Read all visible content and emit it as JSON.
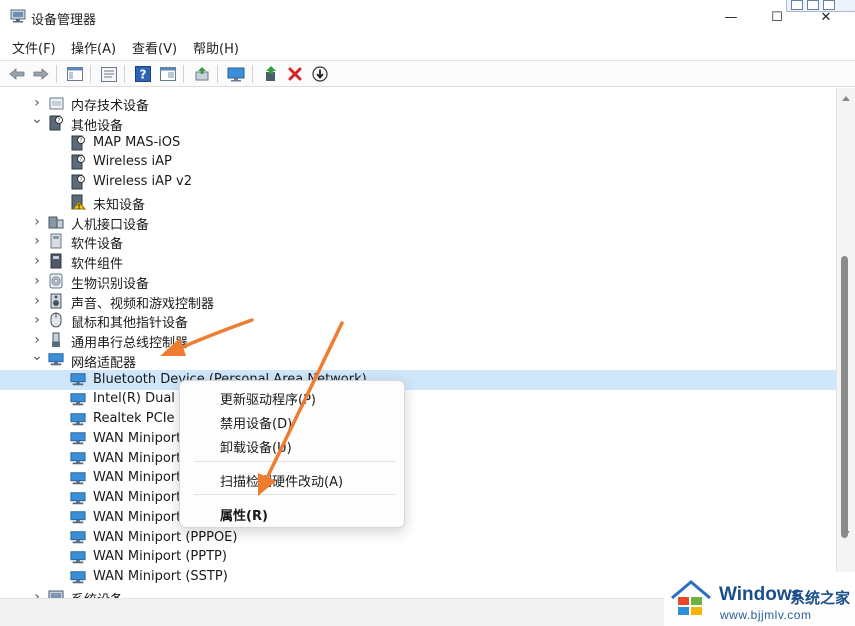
{
  "window": {
    "title": "设备管理器",
    "minimize_glyph": "—",
    "maximize_glyph": "☐",
    "close_glyph": "✕"
  },
  "menu": [
    "文件(F)",
    "操作(A)",
    "查看(V)",
    "帮助(H)"
  ],
  "toolbar": [
    "back-arrow-icon",
    "forward-arrow-icon",
    "show-hide-tree-icon",
    "properties-icon",
    "help-icon",
    "console-view-icon",
    "update-driver-icon",
    "monitor-icon",
    "enable-device-icon",
    "uninstall-icon",
    "download-icon"
  ],
  "tree": [
    {
      "label": "内存技术设备",
      "state": "collapsed",
      "level": 0,
      "icon": "memory-icon"
    },
    {
      "label": "其他设备",
      "state": "expanded",
      "level": 0,
      "icon": "other-device-icon"
    },
    {
      "label": "MAP MAS-iOS",
      "level": 1,
      "icon": "unknown-device-icon"
    },
    {
      "label": "Wireless iAP",
      "level": 1,
      "icon": "unknown-device-icon"
    },
    {
      "label": "Wireless iAP v2",
      "level": 1,
      "icon": "unknown-device-icon"
    },
    {
      "label": "未知设备",
      "level": 1,
      "icon": "warning-device-icon"
    },
    {
      "label": "人机接口设备",
      "state": "collapsed",
      "level": 0,
      "icon": "hid-icon"
    },
    {
      "label": "软件设备",
      "state": "collapsed",
      "level": 0,
      "icon": "software-device-icon"
    },
    {
      "label": "软件组件",
      "state": "collapsed",
      "level": 0,
      "icon": "software-component-icon"
    },
    {
      "label": "生物识别设备",
      "state": "collapsed",
      "level": 0,
      "icon": "fingerprint-icon"
    },
    {
      "label": "声音、视频和游戏控制器",
      "state": "collapsed",
      "level": 0,
      "icon": "speaker-icon"
    },
    {
      "label": "鼠标和其他指针设备",
      "state": "collapsed",
      "level": 0,
      "icon": "mouse-icon"
    },
    {
      "label": "通用串行总线控制器",
      "state": "collapsed",
      "level": 0,
      "icon": "usb-icon"
    },
    {
      "label": "网络适配器",
      "state": "expanded",
      "level": 0,
      "icon": "network-icon"
    },
    {
      "label": "Bluetooth Device (Personal Area Network)",
      "level": 1,
      "icon": "network-adapter-icon",
      "selected": true
    },
    {
      "label": "Intel(R) Dual B",
      "level": 1,
      "icon": "network-adapter-icon"
    },
    {
      "label": "Realtek PCIe G",
      "level": 1,
      "icon": "network-adapter-icon"
    },
    {
      "label": "WAN Miniport",
      "level": 1,
      "icon": "network-adapter-icon"
    },
    {
      "label": "WAN Miniport",
      "level": 1,
      "icon": "network-adapter-icon"
    },
    {
      "label": "WAN Miniport",
      "level": 1,
      "icon": "network-adapter-icon"
    },
    {
      "label": "WAN Miniport",
      "level": 1,
      "icon": "network-adapter-icon"
    },
    {
      "label": "WAN Miniport",
      "level": 1,
      "icon": "network-adapter-icon"
    },
    {
      "label": "WAN Miniport (PPPOE)",
      "level": 1,
      "icon": "network-adapter-icon"
    },
    {
      "label": "WAN Miniport (PPTP)",
      "level": 1,
      "icon": "network-adapter-icon"
    },
    {
      "label": "WAN Miniport (SSTP)",
      "level": 1,
      "icon": "network-adapter-icon"
    },
    {
      "label": "系统设备",
      "state": "collapsed",
      "level": 0,
      "icon": "system-device-icon"
    }
  ],
  "context_menu": {
    "items": [
      "更新驱动程序(P)",
      "禁用设备(D)",
      "卸载设备(U)",
      "扫描检测硬件改动(A)",
      "属性(R)"
    ]
  },
  "watermark": {
    "brand": "Windows",
    "subtitle": "系统之家",
    "url": "www.bjjmlv.com"
  },
  "colors": {
    "selection": "#cfe6fb",
    "annotation_arrow": "#ee7d31",
    "network_icon": "#2f8fd8"
  }
}
